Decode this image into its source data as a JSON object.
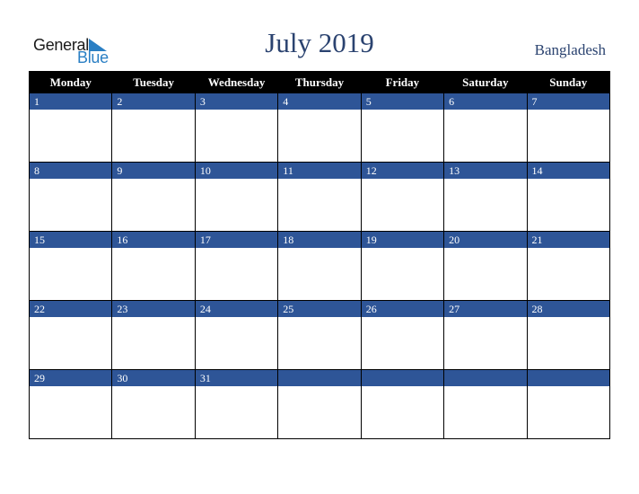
{
  "brand": {
    "general": "General",
    "blue": "Blue"
  },
  "title": "July 2019",
  "country": "Bangladesh",
  "colors": {
    "header_bg": "#000000",
    "date_bar": "#2e5597",
    "title": "#2b4370",
    "brand_blue": "#2a7fc4"
  },
  "weekdays": [
    "Monday",
    "Tuesday",
    "Wednesday",
    "Thursday",
    "Friday",
    "Saturday",
    "Sunday"
  ],
  "weeks": [
    [
      "1",
      "2",
      "3",
      "4",
      "5",
      "6",
      "7"
    ],
    [
      "8",
      "9",
      "10",
      "11",
      "12",
      "13",
      "14"
    ],
    [
      "15",
      "16",
      "17",
      "18",
      "19",
      "20",
      "21"
    ],
    [
      "22",
      "23",
      "24",
      "25",
      "26",
      "27",
      "28"
    ],
    [
      "29",
      "30",
      "31",
      "",
      "",
      "",
      ""
    ]
  ]
}
